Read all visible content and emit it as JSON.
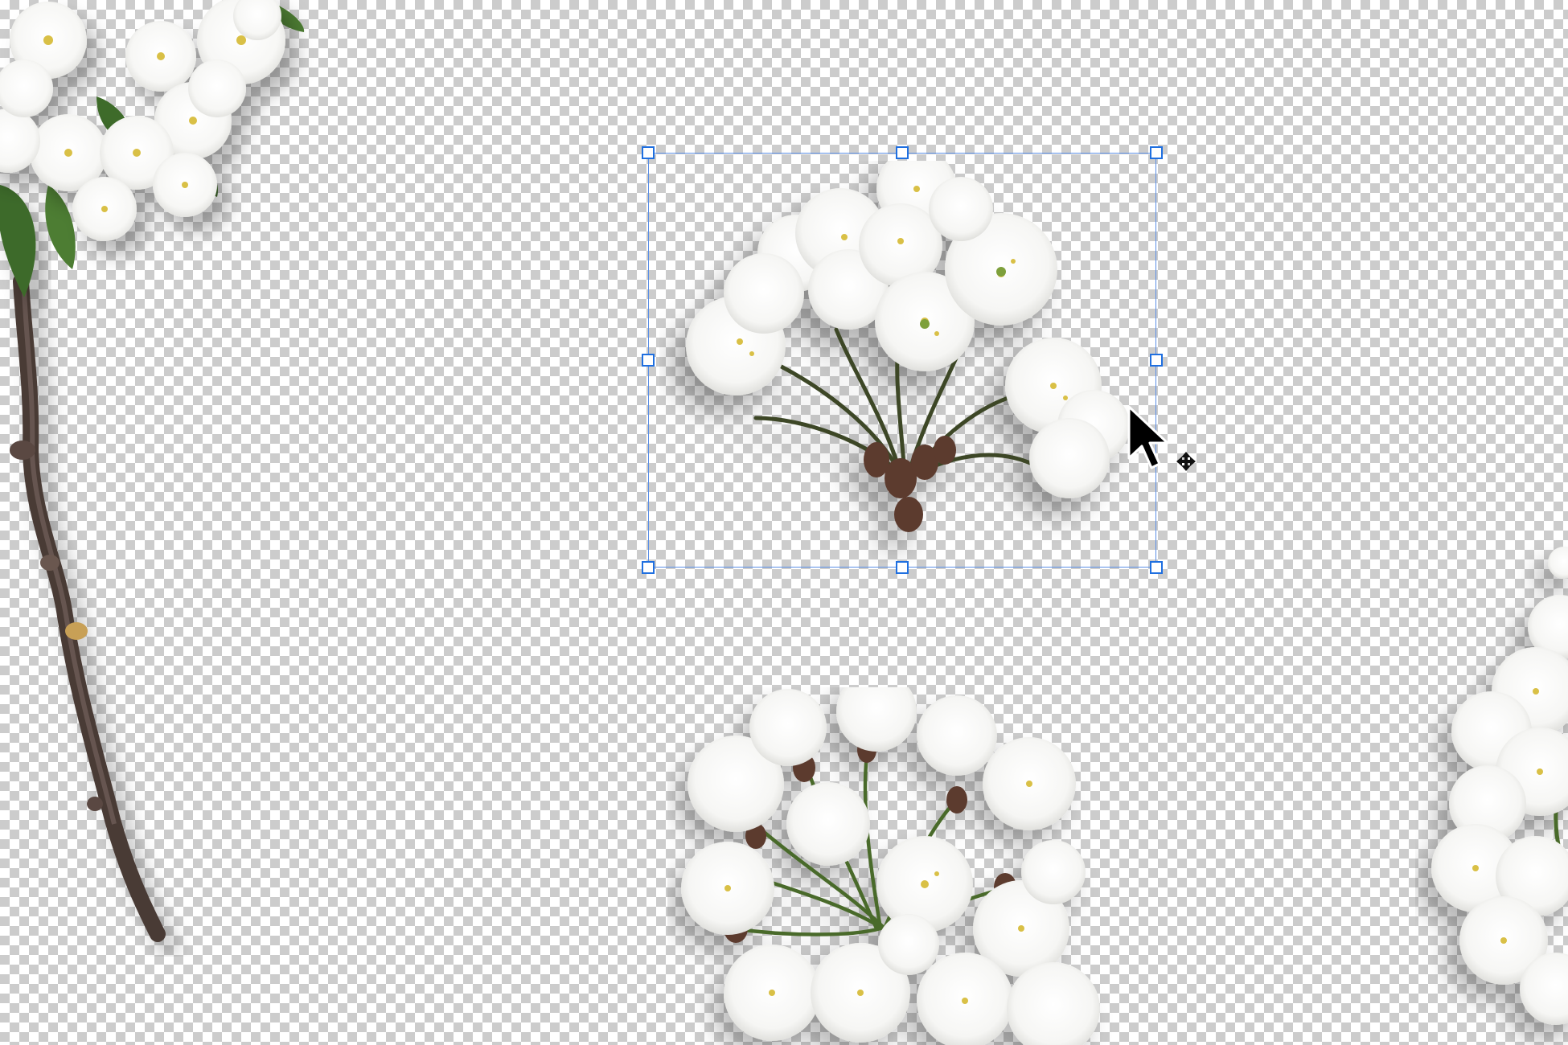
{
  "canvas": {
    "background": "transparency-checkerboard",
    "checker_colors": [
      "#ffffff",
      "#cccccc"
    ]
  },
  "layers": [
    {
      "name": "cherry-blossom-branch",
      "selected": false
    },
    {
      "name": "cherry-blossom-cluster",
      "selected": true
    },
    {
      "name": "cherry-blossom-bunch",
      "selected": false
    },
    {
      "name": "cherry-blossom-edge-cluster",
      "selected": false
    }
  ],
  "selection": {
    "handles": 8,
    "border_color": "#5b8fe6",
    "handle_color": "#1f6fe0"
  },
  "cursor": {
    "pointer_icon": "arrow-pointer-icon",
    "badge_icon": "move-icon"
  }
}
